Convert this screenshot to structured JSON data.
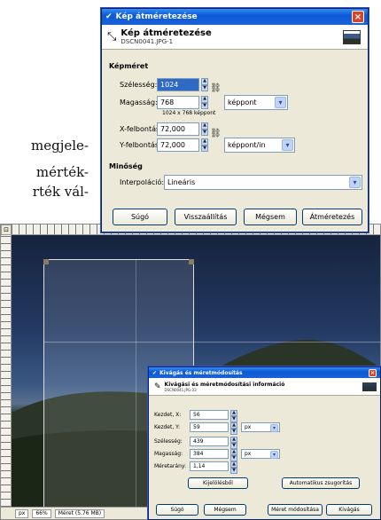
{
  "background_text": [
    "megjele-",
    "mérték-",
    "rték vál-"
  ],
  "resize_dialog": {
    "title": "Kép átméretezése",
    "header_title": "Kép átméretezése",
    "header_subtitle": "DSCN0041.JPG-1",
    "section_size": "Képméret",
    "width_label": "Szélesség:",
    "width_value": "1024",
    "height_label": "Magasság:",
    "height_value": "768",
    "unit_value": "képpont",
    "size_info": "1024 x 768 képpont",
    "xres_label": "X-felbontás:",
    "xres_value": "72,000",
    "yres_label": "Y-felbontás:",
    "yres_value": "72,000",
    "res_unit_value": "képpont/in",
    "section_quality": "Minőség",
    "interp_label": "Interpoláció:",
    "interp_value": "Lineáris",
    "buttons": {
      "help": "Súgó",
      "reset": "Visszaállítás",
      "cancel": "Mégsem",
      "resize": "Átméretezés"
    }
  },
  "crop_dialog": {
    "title": "Kivágás és méretmódosítás",
    "header_title": "Kivágási és méretmódosítási információ",
    "header_subtitle": "DSCN0041.JPG-33",
    "x_label": "Kezdet, X:",
    "x_value": "56",
    "y_label": "Kezdet, Y:",
    "y_value": "59",
    "unit_value": "px",
    "width_label": "Szélesség:",
    "width_value": "439",
    "height_label": "Magasság:",
    "height_value": "384",
    "height_unit": "px",
    "ratio_label": "Méretarány:",
    "ratio_value": "1,14",
    "from_selection": "Kijelölésből",
    "auto_shrink": "Automatikus zsugorítás",
    "buttons": {
      "help": "Súgó",
      "cancel": "Mégsem",
      "resize": "Méret módosítása",
      "crop": "Kivágás"
    }
  },
  "statusbar": {
    "unit": "px",
    "zoom": "66%",
    "info": "Méret (5.76 MB)"
  }
}
